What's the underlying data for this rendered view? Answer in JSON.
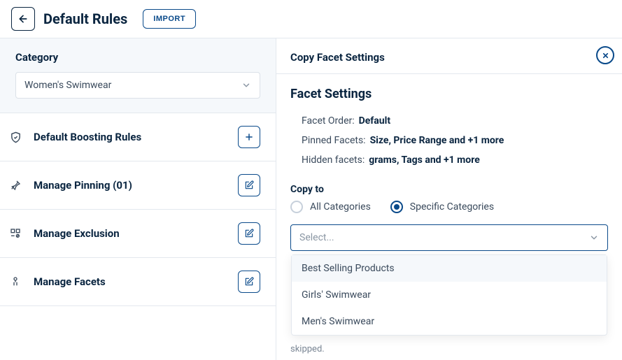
{
  "header": {
    "title": "Default Rules",
    "import_label": "IMPORT"
  },
  "left": {
    "category_label": "Category",
    "category_value": "Women's Swimwear",
    "sections": [
      {
        "label": "Default Boosting Rules",
        "action": "add"
      },
      {
        "label": "Manage Pinning (01)",
        "action": "edit"
      },
      {
        "label": "Manage Exclusion",
        "action": "edit"
      },
      {
        "label": "Manage Facets",
        "action": "edit"
      }
    ]
  },
  "panel": {
    "title": "Copy Facet Settings",
    "heading": "Facet Settings",
    "facet_order_key": "Facet Order:",
    "facet_order_val": "Default",
    "pinned_key": "Pinned Facets:",
    "pinned_val": "Size, Price Range and +1 more",
    "hidden_key": "Hidden facets:",
    "hidden_val": "grams, Tags and +1 more",
    "copy_to_label": "Copy to",
    "radio_all": "All Categories",
    "radio_specific": "Specific Categories",
    "select_placeholder": "Select...",
    "options": [
      "Best Selling Products",
      "Girls' Swimwear",
      "Men's Swimwear"
    ],
    "skipped_text": "skipped."
  }
}
